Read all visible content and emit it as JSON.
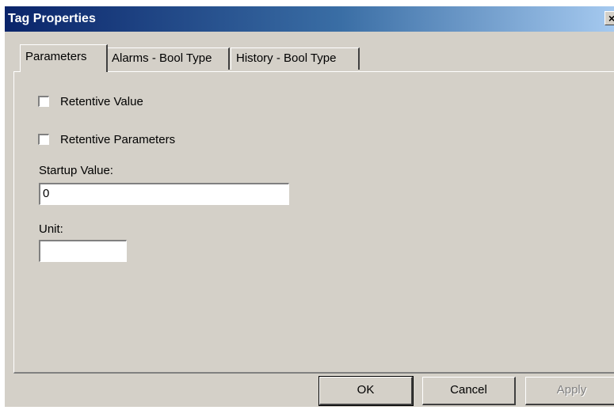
{
  "window": {
    "title": "Tag Properties",
    "close_glyph": "×"
  },
  "tabs": [
    {
      "label": "Parameters",
      "active": true
    },
    {
      "label": "Alarms - Bool Type",
      "active": false
    },
    {
      "label": "History - Bool Type",
      "active": false
    }
  ],
  "parameters": {
    "retentive_value": {
      "label": "Retentive Value",
      "checked": false
    },
    "retentive_parameters": {
      "label": "Retentive Parameters",
      "checked": false
    },
    "startup_value": {
      "label": "Startup Value:",
      "value": "0"
    },
    "unit": {
      "label": "Unit:",
      "value": ""
    }
  },
  "buttons": {
    "ok": "OK",
    "cancel": "Cancel",
    "apply": "Apply",
    "apply_enabled": false
  },
  "colors": {
    "dialog_face": "#d4d0c8",
    "titlebar_start": "#0a246a",
    "titlebar_end": "#a6caf0",
    "disabled_text": "#808080"
  }
}
